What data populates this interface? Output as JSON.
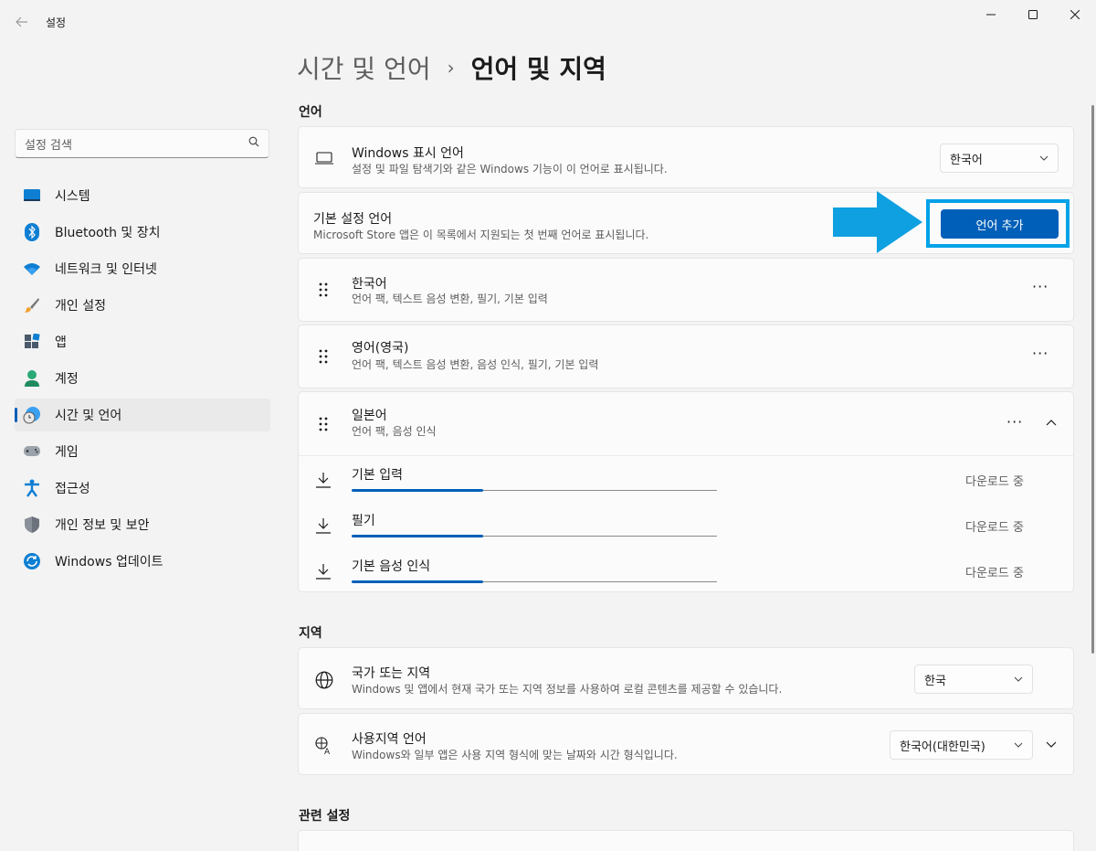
{
  "window": {
    "app_title": "설정",
    "back_icon": "back-arrow-icon",
    "controls": [
      "minimize",
      "maximize",
      "close"
    ]
  },
  "sidebar": {
    "search_placeholder": "설정 검색",
    "items": [
      {
        "label": "시스템",
        "icon": "system-icon"
      },
      {
        "label": "Bluetooth 및 장치",
        "icon": "bluetooth-icon"
      },
      {
        "label": "네트워크 및 인터넷",
        "icon": "wifi-icon"
      },
      {
        "label": "개인 설정",
        "icon": "brush-icon"
      },
      {
        "label": "앱",
        "icon": "apps-icon"
      },
      {
        "label": "계정",
        "icon": "account-icon"
      },
      {
        "label": "시간 및 언어",
        "icon": "time-language-icon",
        "active": true
      },
      {
        "label": "게임",
        "icon": "gamepad-icon"
      },
      {
        "label": "접근성",
        "icon": "accessibility-icon"
      },
      {
        "label": "개인 정보 및 보안",
        "icon": "shield-icon"
      },
      {
        "label": "Windows 업데이트",
        "icon": "update-icon"
      }
    ]
  },
  "breadcrumb": {
    "parent": "시간 및 언어",
    "separator": "›",
    "current": "언어 및 지역"
  },
  "language_section": {
    "header": "언어",
    "display_language": {
      "title": "Windows 표시 언어",
      "subtitle": "설정 및 파일 탐색기와 같은 Windows 기능이 이 언어로 표시됩니다.",
      "value": "한국어"
    },
    "preferred": {
      "title": "기본 설정 언어",
      "subtitle": "Microsoft Store 앱은 이 목록에서 지원되는 첫 번째 언어로 표시됩니다.",
      "add_button": "언어 추가"
    },
    "languages": [
      {
        "name": "한국어",
        "features": "언어 팩, 텍스트 음성 변환, 필기, 기본 입력"
      },
      {
        "name": "영어(영국)",
        "features": "언어 팩, 텍스트 음성 변환, 음성 인식, 필기, 기본 입력"
      },
      {
        "name": "일본어",
        "features": "언어 팩, 음성 인식"
      }
    ],
    "downloads": [
      {
        "name": "기본 입력",
        "status": "다운로드 중",
        "progress": 0.36
      },
      {
        "name": "필기",
        "status": "다운로드 중",
        "progress": 0.36
      },
      {
        "name": "기본 음성 인식",
        "status": "다운로드 중",
        "progress": 0.36
      }
    ]
  },
  "region_section": {
    "header": "지역",
    "country": {
      "title": "국가 또는 지역",
      "subtitle": "Windows 및 앱에서 현재 국가 또는 지역 정보를 사용하여 로컬 콘텐츠를 제공할 수 있습니다.",
      "value": "한국"
    },
    "regional_format": {
      "title": "사용지역 언어",
      "subtitle": "Windows와 일부 앱은 사용 지역 형식에 맞는 날짜와 시간 형식입니다.",
      "value": "한국어(대한민국)"
    }
  },
  "related_section": {
    "header": "관련 설정"
  },
  "colors": {
    "accent": "#005fb8",
    "highlight": "#00a2e8"
  }
}
